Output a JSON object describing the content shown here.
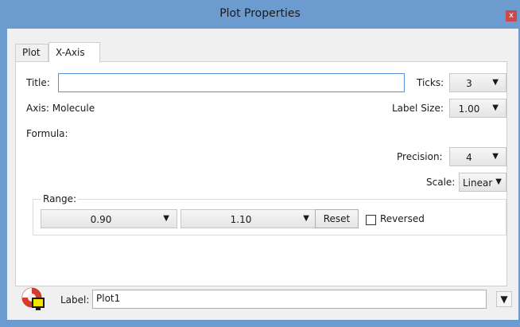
{
  "window": {
    "title": "Plot Properties",
    "close_glyph": "x"
  },
  "tabs": [
    {
      "label": "Plot",
      "active": false
    },
    {
      "label": "X-Axis",
      "active": true
    }
  ],
  "xaxis": {
    "title_label": "Title:",
    "title_value": "",
    "ticks_label": "Ticks:",
    "ticks_value": "3",
    "axis_text": "Axis: Molecule",
    "label_size_label": "Label Size:",
    "label_size_value": "1.00",
    "formula_label": "Formula:",
    "precision_label": "Precision:",
    "precision_value": "4",
    "scale_label": "Scale:",
    "scale_value": "Linear",
    "range": {
      "label": "Range:",
      "min_value": "0.90",
      "max_value": "1.10",
      "reset_label": "Reset",
      "reversed_label": "Reversed",
      "reversed_checked": false
    }
  },
  "bottom": {
    "label_label": "Label:",
    "label_value": "Plot1"
  },
  "icons": {
    "dropdown_glyph": "▼"
  },
  "colors": {
    "titlebar": "#6c9bd0",
    "focus_border": "#5a8fd6",
    "close_button": "#c94a4a"
  }
}
